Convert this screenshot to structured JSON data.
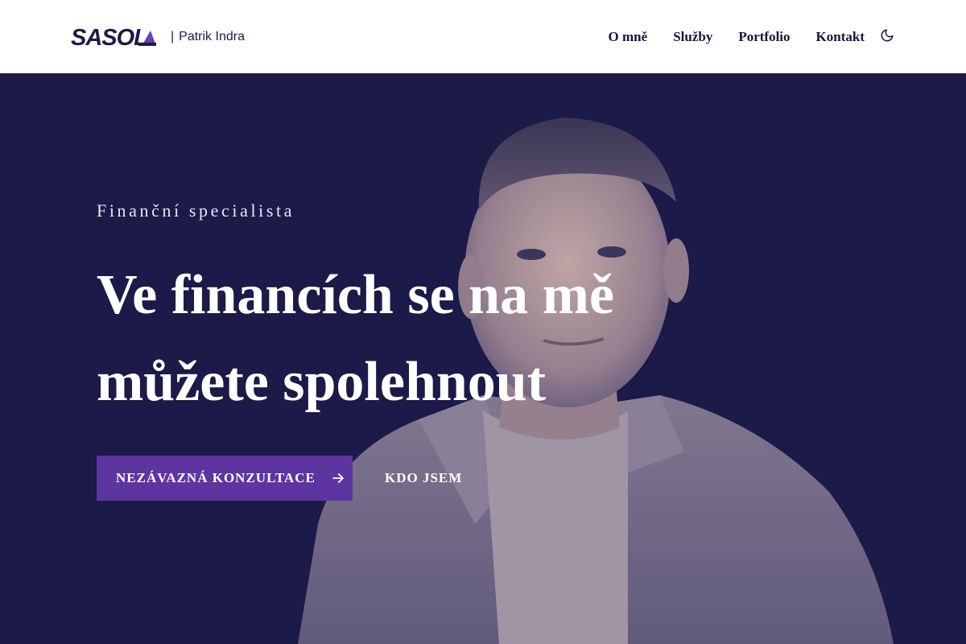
{
  "header": {
    "logo_text": "SASOL",
    "separator": "|",
    "person_name": "Patrik Indra"
  },
  "nav": {
    "items": [
      {
        "label": "O mně"
      },
      {
        "label": "Služby"
      },
      {
        "label": "Portfolio"
      },
      {
        "label": "Kontakt"
      }
    ],
    "theme_icon": "moon-icon"
  },
  "hero": {
    "eyebrow": "Finanční specialista",
    "headline": "Ve financích se na mě můžete spolehnout",
    "primary_cta": "NEZÁVAZNÁ KONZULTACE",
    "primary_cta_icon": "arrow-right-icon",
    "secondary_cta": "KDO JSEM"
  },
  "colors": {
    "header_bg": "#ffffff",
    "hero_bg": "#1c1b48",
    "accent": "#5e35a0",
    "nav_text": "#16163a"
  }
}
